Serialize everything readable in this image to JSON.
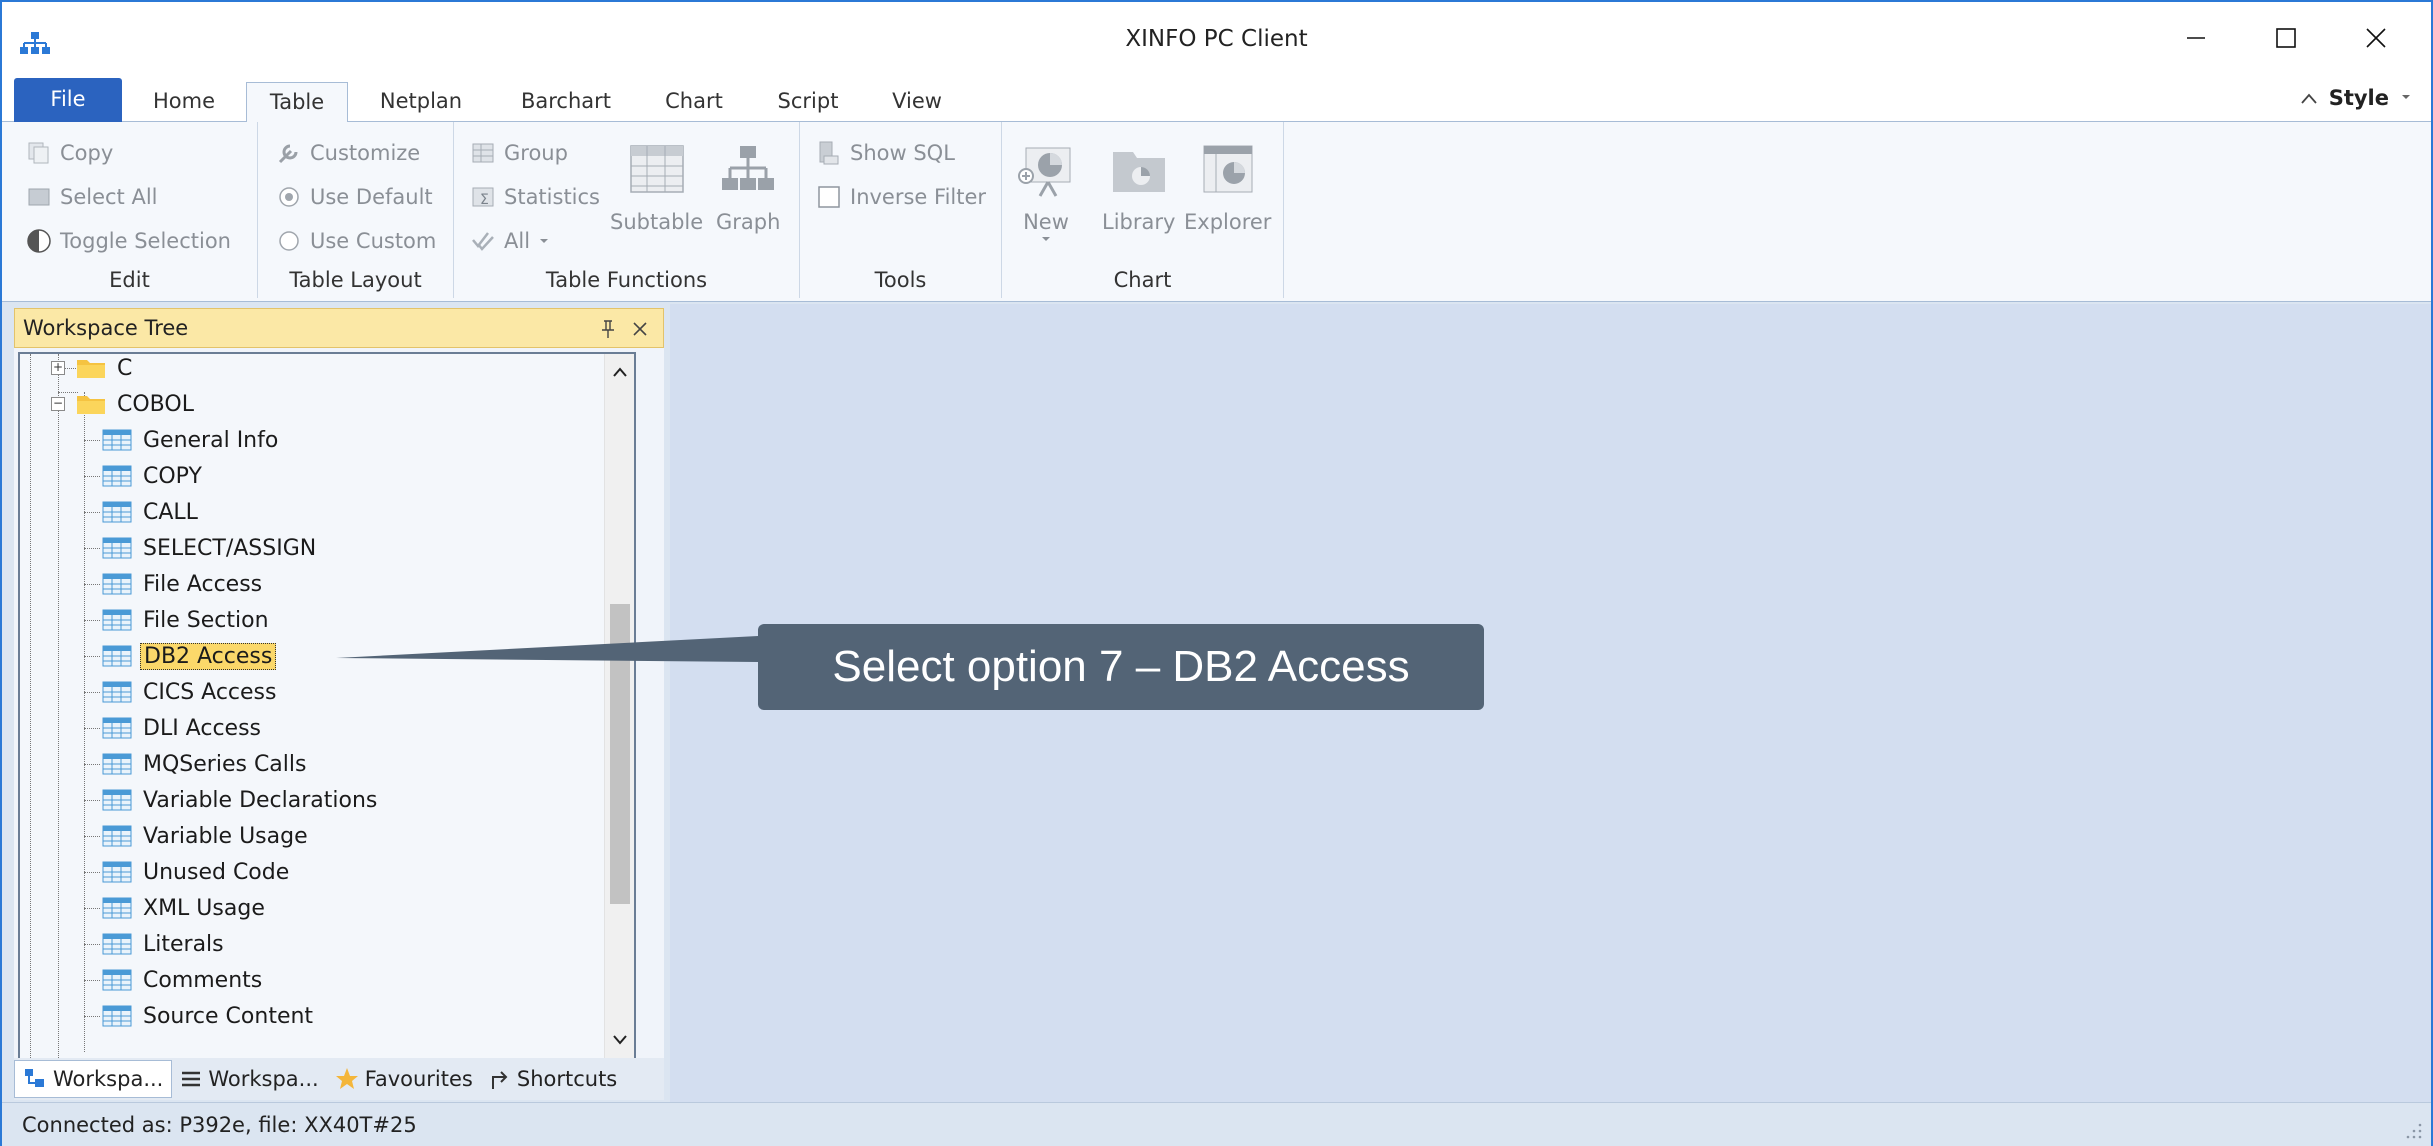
{
  "window": {
    "title": "XINFO PC Client"
  },
  "tabs": [
    "File",
    "Home",
    "Table",
    "Netplan",
    "Barchart",
    "Chart",
    "Script",
    "View"
  ],
  "active_tab": "Table",
  "style_label": "Style",
  "ribbon": {
    "edit": {
      "label": "Edit",
      "copy": "Copy",
      "select_all": "Select All",
      "toggle_selection": "Toggle Selection"
    },
    "table_layout": {
      "label": "Table Layout",
      "customize": "Customize",
      "use_default": "Use Default",
      "use_custom": "Use Custom"
    },
    "table_functions": {
      "label": "Table Functions",
      "group": "Group",
      "statistics": "Statistics",
      "all": "All",
      "subtable": "Subtable",
      "graph": "Graph"
    },
    "tools": {
      "label": "Tools",
      "show_sql": "Show SQL",
      "inverse_filter": "Inverse Filter"
    },
    "chart": {
      "label": "Chart",
      "new": "New",
      "library": "Library",
      "explorer": "Explorer"
    }
  },
  "workspace": {
    "title": "Workspace Tree",
    "folders": [
      "C",
      "COBOL"
    ],
    "items": [
      "General Info",
      "COPY",
      "CALL",
      "SELECT/ASSIGN",
      "File Access",
      "File Section",
      "DB2 Access",
      "CICS Access",
      "DLI Access",
      "MQSeries Calls",
      "Variable Declarations",
      "Variable Usage",
      "Unused Code",
      "XML Usage",
      "Literals",
      "Comments",
      "Source Content"
    ],
    "selected": "DB2 Access"
  },
  "bottom_tabs": [
    "Workspa...",
    "Workspa...",
    "Favourites",
    "Shortcuts"
  ],
  "callout": "Select option 7 – DB2 Access",
  "status": "Connected as: P392e, file: XX40T#25",
  "colors": {
    "accent": "#2b63bf",
    "callout_bg": "#536476",
    "header_bg": "#fbe8a6",
    "selection": "#fbd86a",
    "main_bg": "#d3def0"
  }
}
